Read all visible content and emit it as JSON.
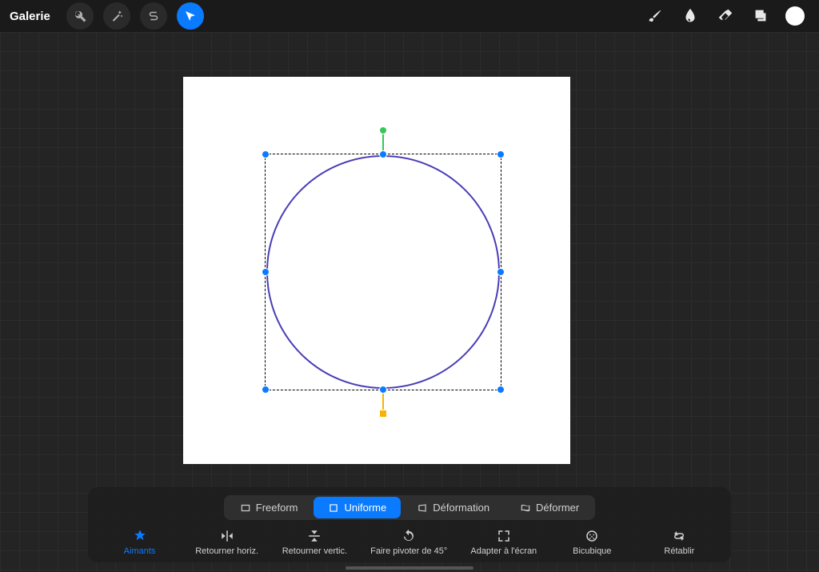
{
  "topbar": {
    "gallery": "Galerie"
  },
  "transform_modes": {
    "freeform": "Freeform",
    "uniform": "Uniforme",
    "distort": "Déformation",
    "warp": "Déformer"
  },
  "actions": {
    "magnetics": "Aimants",
    "flip_h": "Retourner horiz.",
    "flip_v": "Retourner vertic.",
    "rotate45": "Faire pivoter de 45°",
    "fit": "Adapter à l'écran",
    "bicubic": "Bicubique",
    "reset": "Rétablir"
  },
  "colors": {
    "accent": "#0a7aff",
    "shape_stroke": "#4a3db8",
    "rotation_top": "#35c759",
    "rotation_bottom": "#f7b500"
  }
}
